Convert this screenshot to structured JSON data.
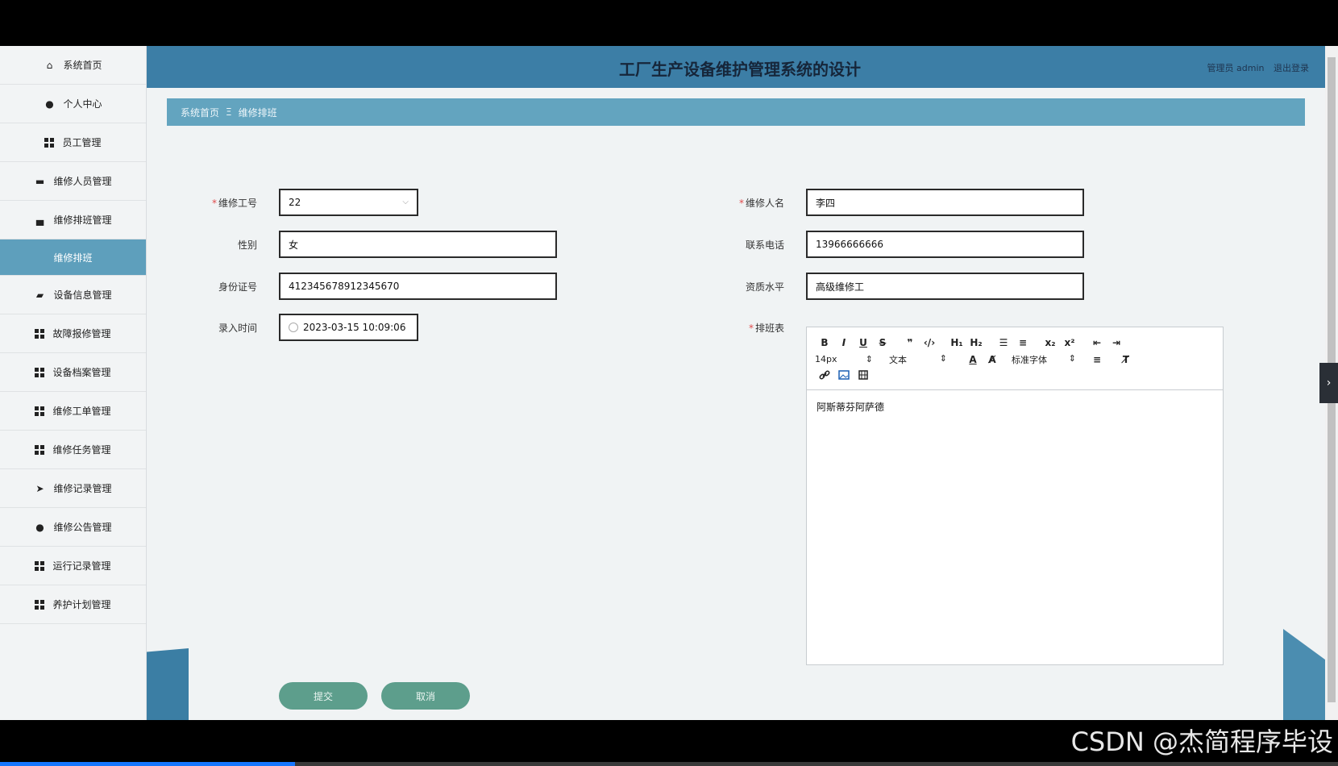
{
  "app_title": "工厂生产设备维护管理系统的设计",
  "header": {
    "role_user": "管理员 admin",
    "logout": "退出登录"
  },
  "sidebar": {
    "items": [
      {
        "label": "系统首页",
        "icon": "home-icon"
      },
      {
        "label": "个人中心",
        "icon": "user-icon"
      },
      {
        "label": "员工管理",
        "icon": "grid-icon"
      },
      {
        "label": "维修人员管理",
        "icon": "chat-icon"
      },
      {
        "label": "维修排班管理",
        "icon": "monitor-icon"
      },
      {
        "label": "维修排班",
        "icon": "",
        "active": true
      },
      {
        "label": "设备信息管理",
        "icon": "briefcase-icon"
      },
      {
        "label": "故障报修管理",
        "icon": "grid-icon"
      },
      {
        "label": "设备档案管理",
        "icon": "grid-icon"
      },
      {
        "label": "维修工单管理",
        "icon": "grid-icon"
      },
      {
        "label": "维修任务管理",
        "icon": "grid-icon"
      },
      {
        "label": "维修记录管理",
        "icon": "send-icon"
      },
      {
        "label": "维修公告管理",
        "icon": "user-icon"
      },
      {
        "label": "运行记录管理",
        "icon": "grid-icon"
      },
      {
        "label": "养护计划管理",
        "icon": "grid-icon"
      }
    ]
  },
  "breadcrumb": {
    "home": "系统首页",
    "sep": "Ξ",
    "current": "维修排班"
  },
  "form": {
    "repair_id": {
      "label": "维修工号",
      "value": "22"
    },
    "repair_name": {
      "label": "维修人名",
      "value": "李四"
    },
    "gender": {
      "label": "性别",
      "value": "女"
    },
    "phone": {
      "label": "联系电话",
      "value": "13966666666"
    },
    "id_card": {
      "label": "身份证号",
      "value": "412345678912345670"
    },
    "qualification": {
      "label": "资质水平",
      "value": "高级维修工"
    },
    "entry_time": {
      "label": "录入时间",
      "value": "2023-03-15 10:09:06"
    },
    "schedule": {
      "label": "排班表",
      "content": "阿斯蒂芬阿萨德"
    }
  },
  "editor": {
    "font_size": "14px",
    "text_type": "文本",
    "font_family": "标准字体",
    "row1": [
      "B",
      "I",
      "U",
      "S",
      "❞",
      "‹/›",
      "H₁",
      "H₂",
      "☰",
      "≡",
      "x₂",
      "x²",
      "⇤",
      "⇥"
    ],
    "icons": {
      "color": "A",
      "bg": "A̸",
      "align": "≡",
      "clear": "T̸"
    }
  },
  "buttons": {
    "submit": "提交",
    "cancel": "取消"
  },
  "watermark": "CSDN @杰简程序毕设",
  "colors": {
    "header": "#3c7ea6",
    "breadcrumb": "#63a4bf",
    "active": "#5e9fbc",
    "button": "#5d9e8c"
  }
}
